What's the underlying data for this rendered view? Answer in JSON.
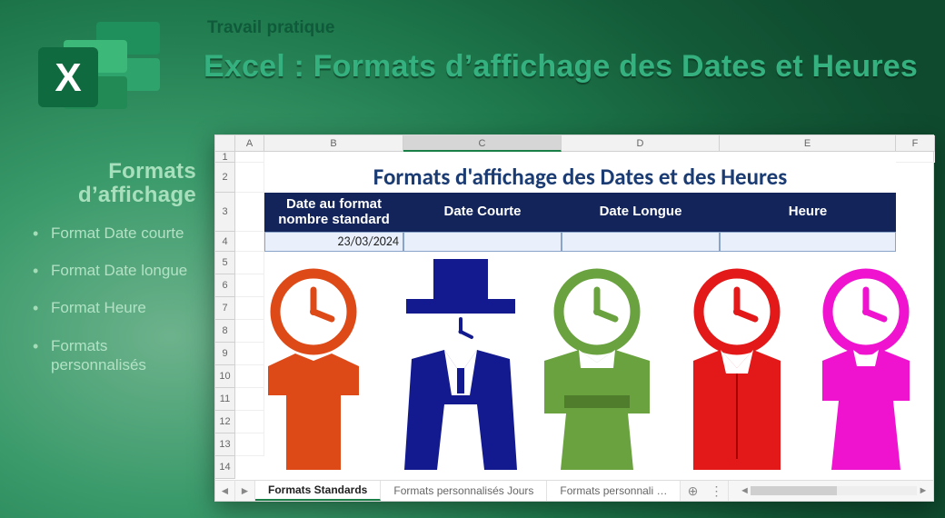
{
  "header": {
    "pretitle": "Travail pratique",
    "title": "Excel : Formats d’affichage des Dates et Heures"
  },
  "sidebar": {
    "heading_line1": "Formats",
    "heading_line2": "d’affichage",
    "items": [
      "Format Date courte",
      "Format Date longue",
      "Format Heure",
      "Formats personnalisés"
    ]
  },
  "sheet": {
    "columns": [
      "A",
      "B",
      "C",
      "D",
      "E",
      "F"
    ],
    "selected_column_index": 2,
    "rows": [
      "1",
      "2",
      "3",
      "4",
      "5",
      "6",
      "7",
      "8",
      "9",
      "10",
      "11",
      "12",
      "13",
      "14"
    ],
    "title": "Formats d'affichage des Dates et des Heures",
    "headers": {
      "B": "Date au format nombre standard",
      "C": "Date Courte",
      "D": "Date Longue",
      "E": "Heure"
    },
    "row4": {
      "B": "23/03/2024",
      "C": "",
      "D": "",
      "E": ""
    }
  },
  "tabs": {
    "items": [
      {
        "label": "Formats Standards",
        "active": true
      },
      {
        "label": "Formats personnalisés Jours",
        "active": false
      },
      {
        "label": "Formats personnali  …",
        "active": false
      }
    ]
  },
  "figures": [
    {
      "name": "figure-orange-tshirt",
      "color": "#dd4a17"
    },
    {
      "name": "figure-navy-tophat",
      "color": "#131a8f"
    },
    {
      "name": "figure-green-kimono",
      "color": "#69a23e"
    },
    {
      "name": "figure-red-shirt",
      "color": "#e31818"
    },
    {
      "name": "figure-magenta-dress",
      "color": "#ef13d0"
    }
  ]
}
